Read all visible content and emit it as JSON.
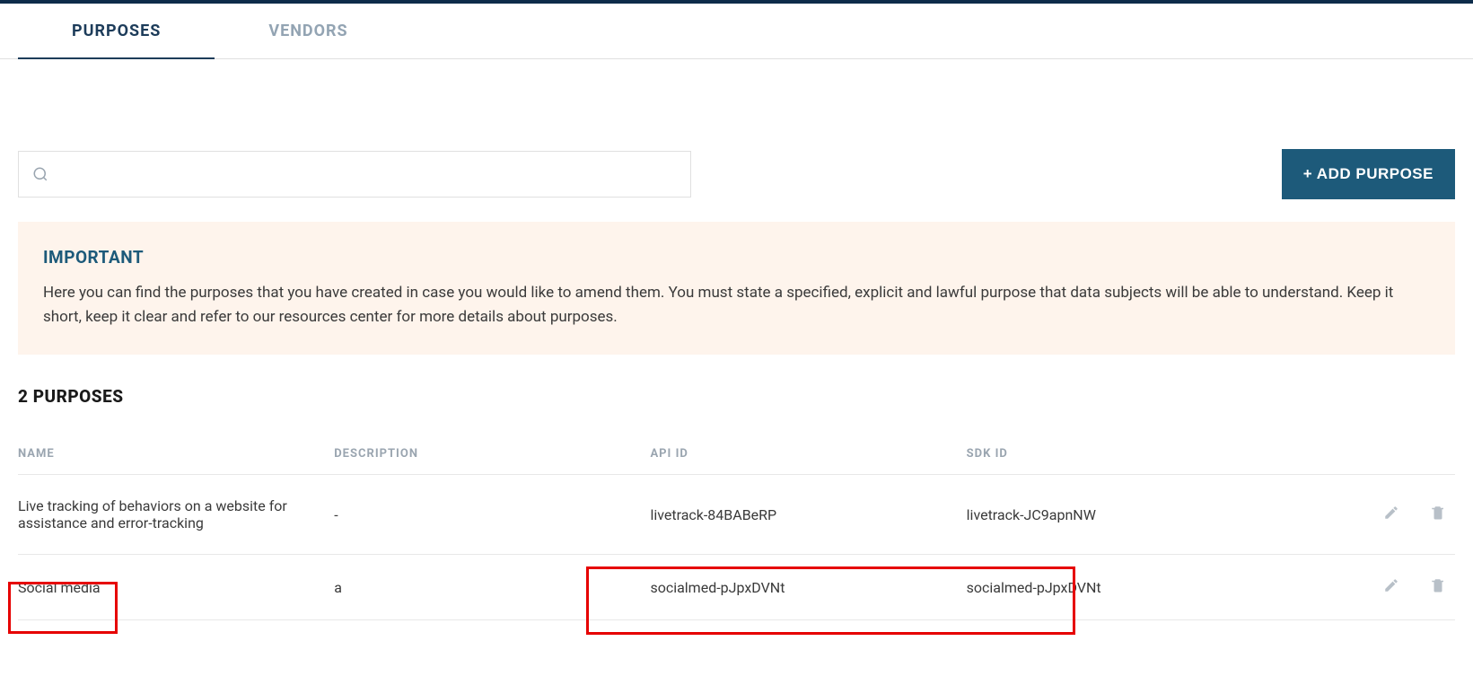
{
  "tabs": {
    "purposes": "PURPOSES",
    "vendors": "VENDORS"
  },
  "search": {
    "placeholder": ""
  },
  "add_button": "+ ADD PURPOSE",
  "important": {
    "title": "IMPORTANT",
    "text": "Here you can find the purposes that you have created in case you would like to amend them. You must state a specified, explicit and lawful purpose that data subjects will be able to understand. Keep it short, keep it clear and refer to our resources center for more details about purposes."
  },
  "count_title": "2 PURPOSES",
  "table": {
    "headers": {
      "name": "NAME",
      "description": "DESCRIPTION",
      "api_id": "API ID",
      "sdk_id": "SDK ID"
    },
    "rows": [
      {
        "name": "Live tracking of behaviors on a website for assistance and error-tracking",
        "description": "-",
        "api_id": "livetrack-84BABeRP",
        "sdk_id": "livetrack-JC9apnNW"
      },
      {
        "name": "Social media",
        "description": "a",
        "api_id": "socialmed-pJpxDVNt",
        "sdk_id": "socialmed-pJpxDVNt"
      }
    ]
  }
}
